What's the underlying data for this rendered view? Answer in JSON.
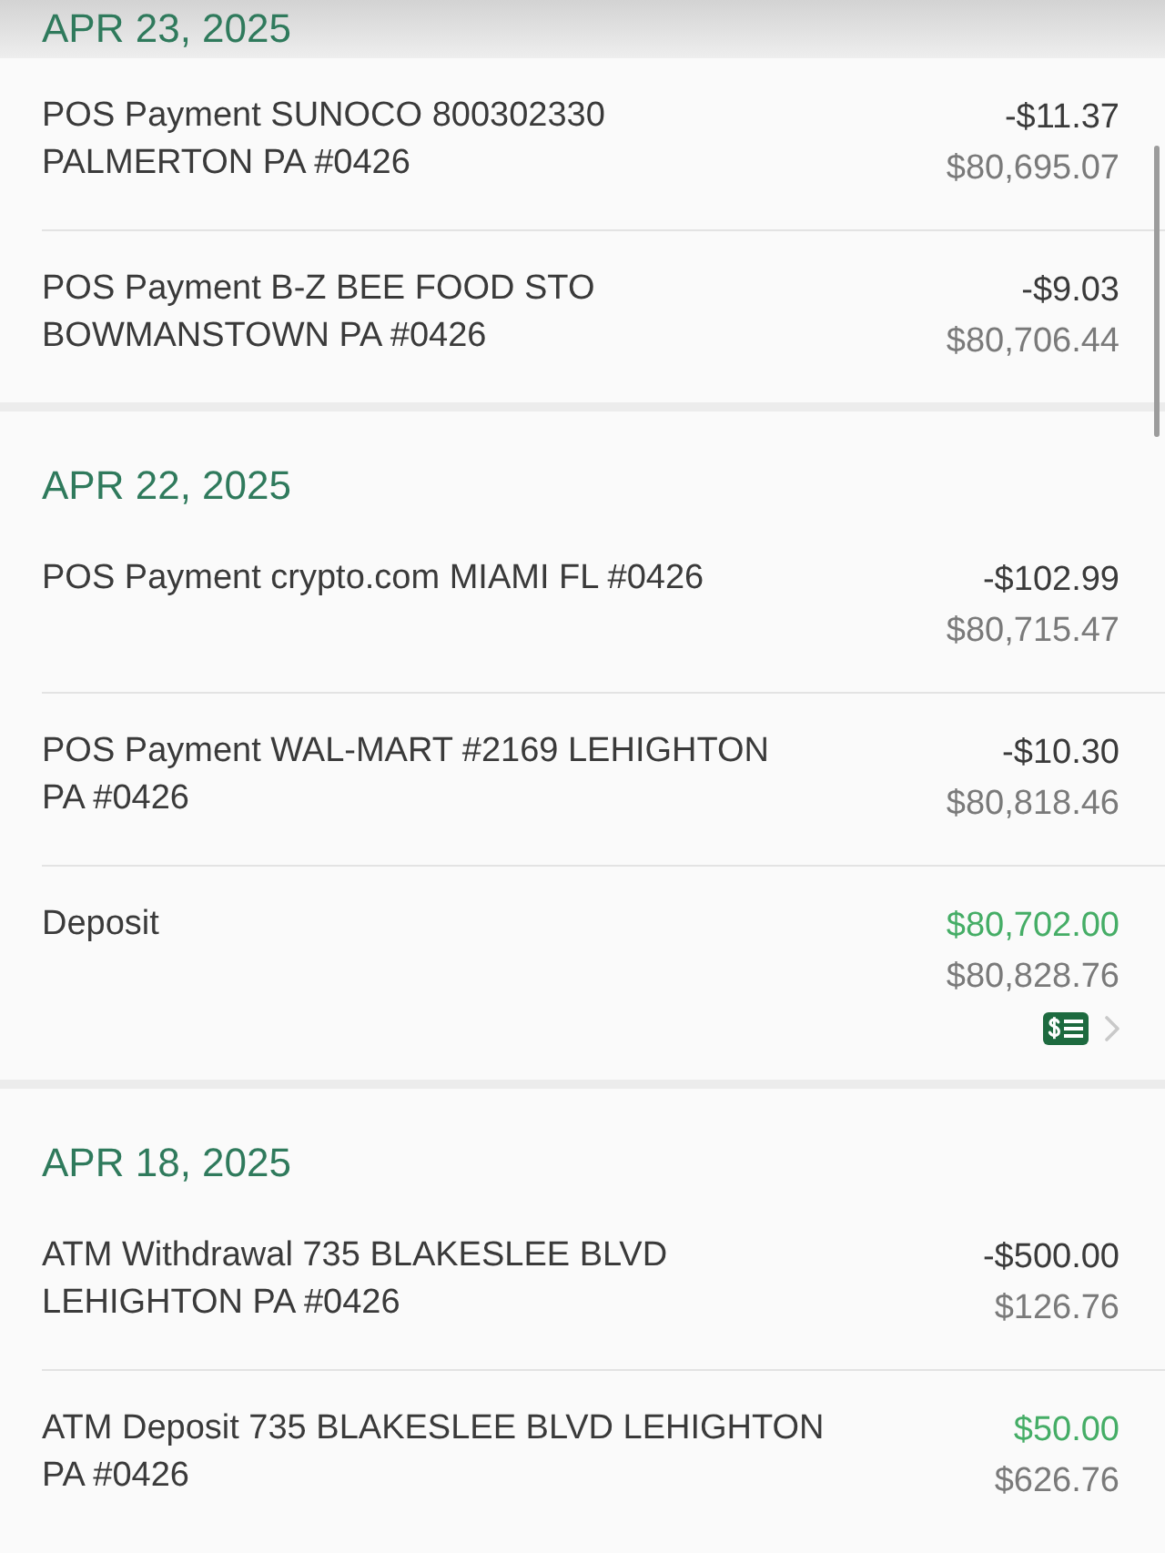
{
  "sections": [
    {
      "date": "APR 23, 2025",
      "pinned": true,
      "transactions": [
        {
          "description": "POS Payment SUNOCO 800302330\nPALMERTON PA #0426",
          "amount": "-$11.37",
          "balance": "$80,695.07",
          "kind": "debit",
          "check_image": false
        },
        {
          "description": "POS Payment B-Z BEE FOOD STO\nBOWMANSTOWN PA #0426",
          "amount": "-$9.03",
          "balance": "$80,706.44",
          "kind": "debit",
          "check_image": false
        }
      ]
    },
    {
      "date": "APR 22, 2025",
      "pinned": false,
      "transactions": [
        {
          "description": "POS Payment crypto.com MIAMI FL #0426",
          "amount": "-$102.99",
          "balance": "$80,715.47",
          "kind": "debit",
          "check_image": false
        },
        {
          "description": "POS Payment WAL-MART #2169 LEHIGHTON\nPA #0426",
          "amount": "-$10.30",
          "balance": "$80,818.46",
          "kind": "debit",
          "check_image": false
        },
        {
          "description": "Deposit",
          "amount": "$80,702.00",
          "balance": "$80,828.76",
          "kind": "credit",
          "check_image": true
        }
      ]
    },
    {
      "date": "APR 18, 2025",
      "pinned": false,
      "transactions": [
        {
          "description": "ATM Withdrawal 735 BLAKESLEE BLVD\nLEHIGHTON PA #0426",
          "amount": "-$500.00",
          "balance": "$126.76",
          "kind": "debit",
          "check_image": false
        },
        {
          "description": "ATM Deposit 735 BLAKESLEE BLVD LEHIGHTON\nPA #0426",
          "amount": "$50.00",
          "balance": "$626.76",
          "kind": "credit",
          "check_image": false
        }
      ]
    }
  ]
}
